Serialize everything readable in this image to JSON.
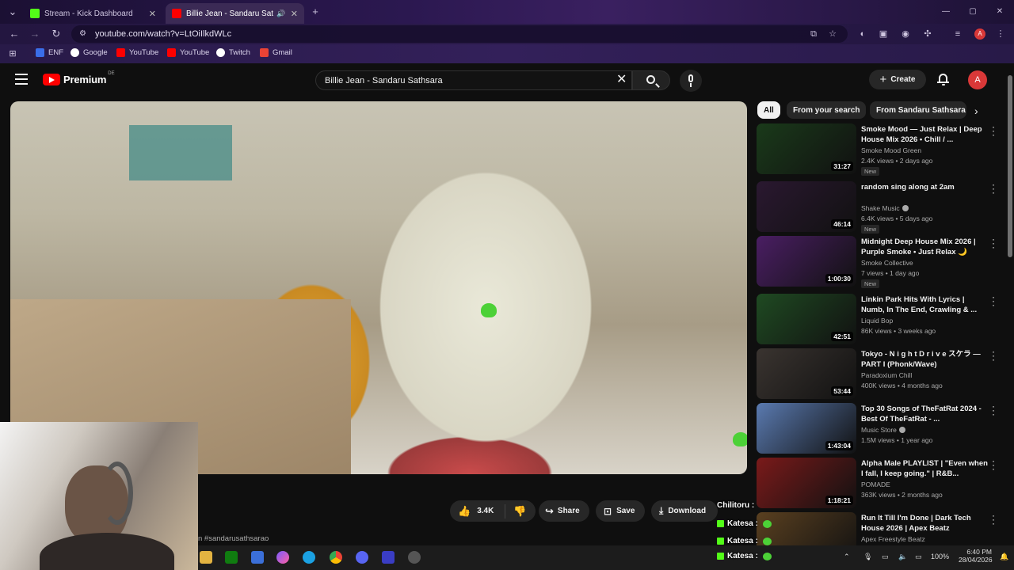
{
  "browser": {
    "tabs": [
      {
        "label": "Stream - Kick Dashboard",
        "favicon": "kick-icon",
        "active": false
      },
      {
        "label": "Billie Jean - Sandaru Sathsa",
        "favicon": "youtube-icon",
        "active": true
      }
    ],
    "address": "youtube.com/watch?v=LtOiIlkdWLc",
    "bookmarks": [
      {
        "label": "ENF",
        "color": "#3a6ee8"
      },
      {
        "label": "Google",
        "color": "#ffffff"
      },
      {
        "label": "YouTube",
        "color": "#ff0000"
      },
      {
        "label": "YouTube",
        "color": "#ff0000"
      },
      {
        "label": "Twitch",
        "color": "#ffffff"
      },
      {
        "label": "Gmail",
        "color": "#ea4335"
      }
    ],
    "profile_initial": "A"
  },
  "youtube": {
    "logo_text": "Premium",
    "country_code": "DE",
    "search_value": "Billie Jean - Sandaru Sathsara",
    "create_label": "Create",
    "avatar_initial": "A",
    "accent": "#ff0000"
  },
  "actions": {
    "likes": "3.4K",
    "share": "Share",
    "save": "Save",
    "download": "Download"
  },
  "description_snippet": "n #sandarusathsarao",
  "chips": [
    "All",
    "From your search",
    "From Sandaru Sathsara"
  ],
  "recommendations": [
    {
      "title": "Smoke Mood — Just Relax | Deep House Mix 2026 • Chill / ...",
      "channel": "Smoke Mood Green",
      "meta": "2.4K views • 2 days ago",
      "badge": "New",
      "duration": "31:27",
      "thumb": "#1a3a1a",
      "verified": false
    },
    {
      "title": "random sing along at 2am",
      "channel": "Shake Music",
      "meta": "6.4K views • 5 days ago",
      "badge": "New",
      "duration": "46:14",
      "thumb": "#2a1830",
      "verified": true
    },
    {
      "title": "Midnight Deep House Mix 2026 | Purple Smoke • Just Relax 🌙",
      "channel": "Smoke Collective",
      "meta": "7 views • 1 day ago",
      "badge": "New",
      "duration": "1:00:30",
      "thumb": "#4a1e63",
      "verified": false
    },
    {
      "title": "Linkin Park Hits With Lyrics | Numb, In The End, Crawling & ...",
      "channel": "Liquid Bop",
      "meta": "86K views • 3 weeks ago",
      "badge": "",
      "duration": "42:51",
      "thumb": "#1f4a22",
      "verified": false
    },
    {
      "title": "Tokyo - N i g h t D r i v e スケラ — PART I (Phonk/Wave)",
      "channel": "Paradoxium Chill",
      "meta": "400K views • 4 months ago",
      "badge": "",
      "duration": "53:44",
      "thumb": "#3a3430",
      "verified": false
    },
    {
      "title": "Top 30 Songs of TheFatRat 2024 - Best Of TheFatRat - ...",
      "channel": "Music Store",
      "meta": "1.5M views • 1 year ago",
      "badge": "",
      "duration": "1:43:04",
      "thumb": "#5a7ab0",
      "verified": true
    },
    {
      "title": "Alpha Male PLAYLIST | \"Even when I fall, I keep going.\" | R&B...",
      "channel": "POMADE",
      "meta": "363K views • 2 months ago",
      "badge": "",
      "duration": "1:18:21",
      "thumb": "#7a1a1a",
      "verified": false
    },
    {
      "title": "Run It Till I'm Done | Dark Tech House 2026 | Apex Beatz",
      "channel": "Apex Freestyle Beatz",
      "meta": "",
      "badge": "",
      "duration": "",
      "thumb": "#5a4020",
      "verified": false
    }
  ],
  "chat": [
    {
      "user": "Chilitoru :"
    },
    {
      "user": "Katesa :"
    },
    {
      "user": "Katesa :"
    },
    {
      "user": "Katesa :"
    }
  ],
  "taskbar": {
    "time": "6:40 PM",
    "date": "28/04/2026",
    "battery": "100%"
  }
}
